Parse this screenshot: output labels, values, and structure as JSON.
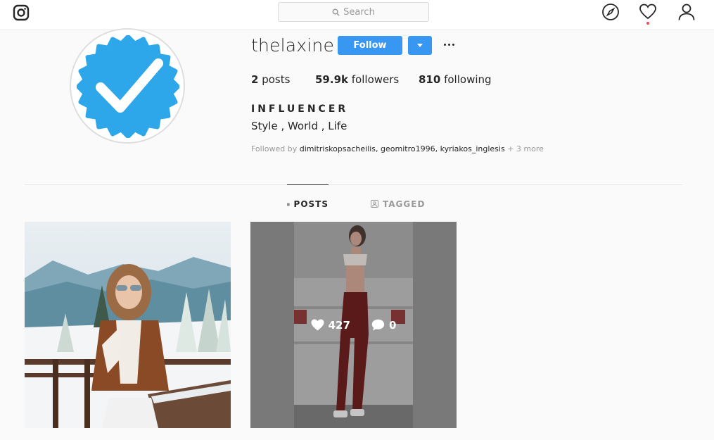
{
  "topbar": {
    "search_placeholder": "Search",
    "icons": [
      "instagram-logo-icon",
      "compass-icon",
      "heart-icon",
      "user-icon"
    ]
  },
  "profile": {
    "username": "thelaxine",
    "follow_label": "Follow",
    "posts_count": "2",
    "posts_label": "posts",
    "followers_count": "59.9k",
    "followers_label": "followers",
    "following_count": "810",
    "following_label": "following",
    "full_name": "INFLUENCER",
    "bio": "Style , World , Life",
    "followed_by_prefix": "Followed by",
    "followed_by_names": "dimitriskopsacheilis, geomitro1996, kyriakos_inglesis",
    "followed_by_more": "+ 3 more"
  },
  "tabs": {
    "posts": "POSTS",
    "tagged": "TAGGED"
  },
  "posts": [
    {
      "description": "snow-mountain-selfie"
    },
    {
      "likes": "427",
      "comments": "0"
    }
  ],
  "colors": {
    "accent": "#3897f0",
    "badge_blue": "#2da7e9",
    "notification_dot": "#ed4956"
  }
}
